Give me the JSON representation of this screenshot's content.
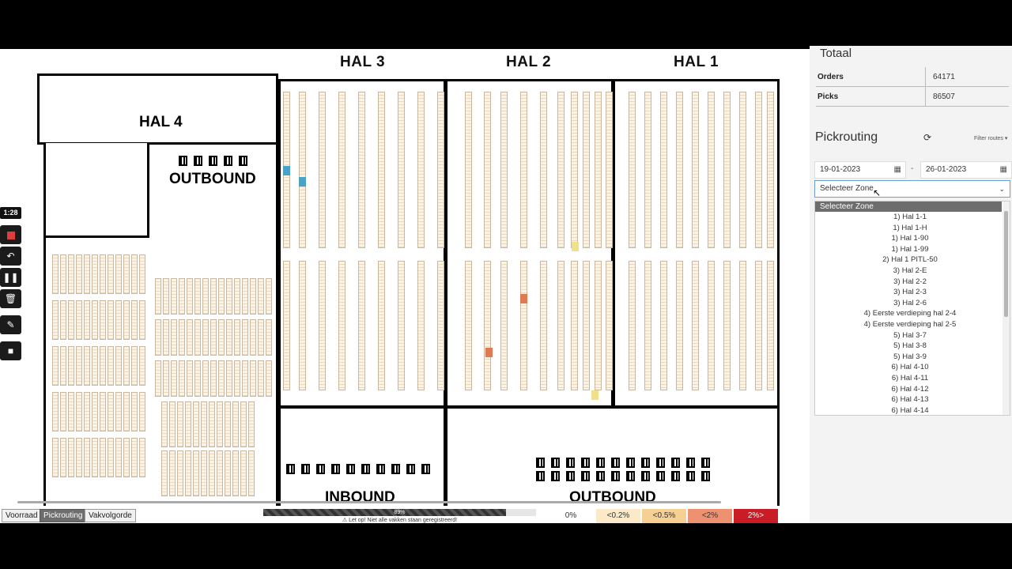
{
  "map": {
    "hal_titles": [
      "HAL 3",
      "HAL 2",
      "HAL 1"
    ],
    "hal4_label": "HAL 4",
    "outbound_top_label": "OUTBOUND",
    "inbound_label": "INBOUND",
    "outbound_bottom_label": "OUTBOUND"
  },
  "recorder": {
    "time": "1:28",
    "tools": [
      "stop-icon",
      "undo-icon",
      "pause-icon",
      "trash-icon",
      "pen-icon",
      "camera-icon"
    ]
  },
  "bottombar": {
    "tabs": [
      {
        "label": "Voorraad",
        "active": false
      },
      {
        "label": "Pickrouting",
        "active": true
      },
      {
        "label": "Vakvolgorde",
        "active": false
      }
    ],
    "progress_percent": 89,
    "progress_label": "89%",
    "warning": "⚠ Let op! Niet alle vakken staan geregistreerd!",
    "legend": [
      {
        "label": "0%",
        "color": "#ffffff"
      },
      {
        "label": "<0.2%",
        "color": "#fbe9c8"
      },
      {
        "label": "<0.5%",
        "color": "#f6cf93"
      },
      {
        "label": "<2%",
        "color": "#ee9171"
      },
      {
        "label": "2%>",
        "color": "#c91c24"
      }
    ]
  },
  "panel": {
    "totaal_title": "Totaal",
    "stats": [
      {
        "label": "Orders",
        "value": "64171"
      },
      {
        "label": "Picks",
        "value": "86507"
      }
    ],
    "pickrouting_title": "Pickrouting",
    "filter_label": "Filter routes",
    "date_from": "19-01-2023",
    "date_to": "26-01-2023",
    "date_separator": "-",
    "zone_placeholder": "Selecteer Zone",
    "dropdown": {
      "selected": "Selecteer Zone",
      "items": [
        "1) Hal 1-1",
        "1) Hal 1-H",
        "1) Hal 1-90",
        "1) Hal 1-99",
        "2) Hal 1 PITL-50",
        "3) Hal 2-E",
        "3) Hal 2-2",
        "3) Hal 2-3",
        "3) Hal 2-6",
        "4) Eerste verdieping hal 2-4",
        "4) Eerste verdieping hal 2-5",
        "5) Hal 3-7",
        "5) Hal 3-8",
        "5) Hal 3-9",
        "6) Hal 4-10",
        "6) Hal 4-11",
        "6) Hal 4-12",
        "6) Hal 4-13",
        "6) Hal 4-14"
      ]
    }
  }
}
